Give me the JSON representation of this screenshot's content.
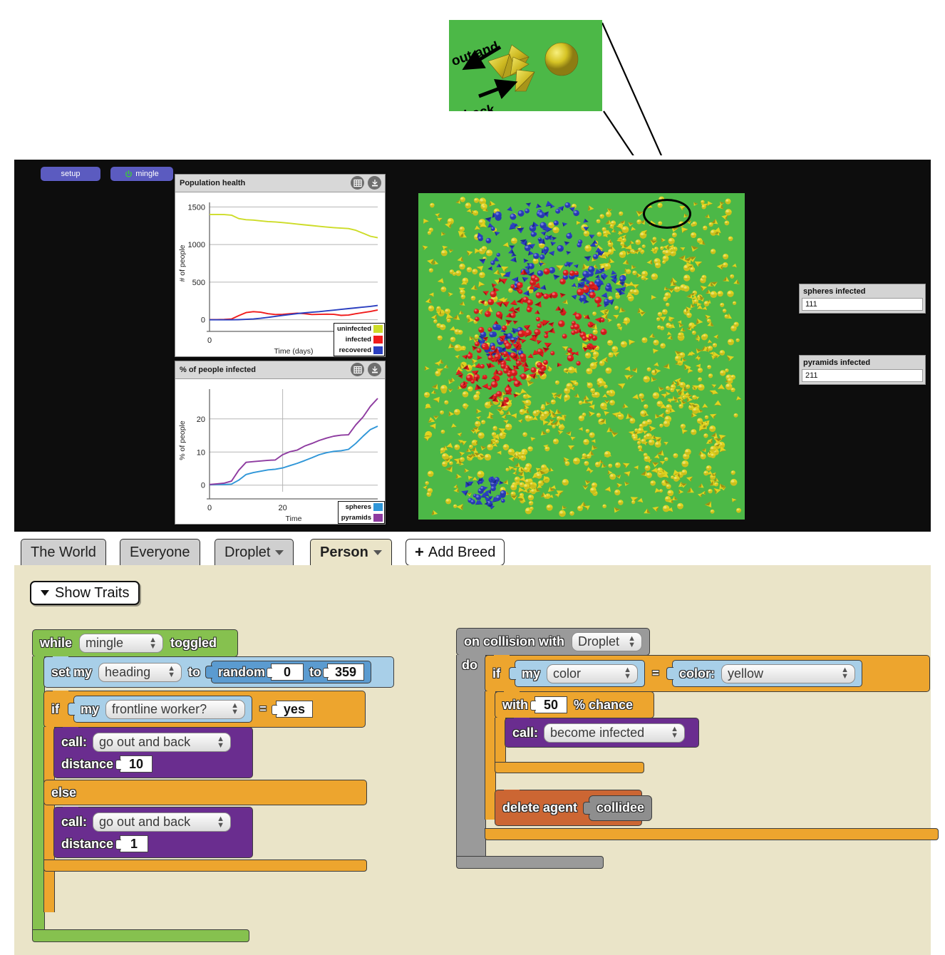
{
  "callout": {
    "label_out": "out and",
    "label_back": "back",
    "bg_color": "#4cb847",
    "agent_color": "#d4c935"
  },
  "toolbar": {
    "setup_label": "setup",
    "mingle_label": "mingle",
    "button_color": "#5b5bc0",
    "power_icon_color": "#3ec93e"
  },
  "charts": [
    {
      "title": "Population health",
      "grid_icon": "table-icon",
      "download_icon": "download-icon"
    },
    {
      "title": "% of people infected",
      "grid_icon": "table-icon",
      "download_icon": "download-icon"
    }
  ],
  "chart_data": [
    {
      "type": "line",
      "title": "Population health",
      "xlabel": "Time (days)",
      "ylabel": "# of people",
      "xlim": [
        0,
        46
      ],
      "ylim": [
        -60,
        1560
      ],
      "xticks": [
        0
      ],
      "yticks": [
        0,
        500,
        1000,
        1500
      ],
      "grid": true,
      "legend_position": "bottom-right",
      "series": [
        {
          "name": "uninfected",
          "color": "#cddc27",
          "x": [
            0,
            2,
            4,
            6,
            8,
            10,
            12,
            14,
            16,
            18,
            20,
            22,
            24,
            26,
            28,
            30,
            32,
            34,
            36,
            38,
            40,
            42,
            44,
            46
          ],
          "values": [
            1400,
            1400,
            1398,
            1390,
            1345,
            1330,
            1325,
            1315,
            1305,
            1300,
            1292,
            1282,
            1272,
            1262,
            1252,
            1242,
            1232,
            1225,
            1218,
            1212,
            1190,
            1150,
            1110,
            1090
          ]
        },
        {
          "name": "infected",
          "color": "#f01c1c",
          "x": [
            0,
            2,
            4,
            6,
            8,
            10,
            12,
            14,
            16,
            18,
            20,
            22,
            24,
            26,
            28,
            30,
            32,
            34,
            36,
            38,
            40,
            42,
            44,
            46
          ],
          "values": [
            2,
            2,
            4,
            10,
            55,
            95,
            108,
            100,
            80,
            70,
            72,
            80,
            88,
            80,
            70,
            72,
            75,
            72,
            58,
            62,
            80,
            95,
            110,
            130
          ]
        },
        {
          "name": "recovered",
          "color": "#2b3fc0",
          "x": [
            0,
            2,
            4,
            6,
            8,
            10,
            12,
            14,
            16,
            18,
            20,
            22,
            24,
            26,
            28,
            30,
            32,
            34,
            36,
            38,
            40,
            42,
            44,
            46
          ],
          "values": [
            0,
            0,
            0,
            0,
            2,
            5,
            10,
            20,
            32,
            45,
            58,
            70,
            82,
            92,
            100,
            108,
            118,
            128,
            138,
            148,
            158,
            168,
            178,
            190
          ]
        }
      ]
    },
    {
      "type": "line",
      "title": "% of people infected",
      "xlabel": "Time",
      "ylabel": "% of people",
      "xlim": [
        0,
        46
      ],
      "ylim": [
        -2,
        29
      ],
      "xticks": [
        0,
        20
      ],
      "yticks": [
        0,
        10,
        20
      ],
      "grid": true,
      "legend_position": "bottom-right",
      "series": [
        {
          "name": "spheres",
          "color": "#2f96d8",
          "x": [
            0,
            2,
            4,
            6,
            8,
            10,
            12,
            14,
            16,
            18,
            20,
            22,
            24,
            26,
            28,
            30,
            32,
            34,
            36,
            38,
            40,
            42,
            44,
            46
          ],
          "values": [
            0.1,
            0.2,
            0.2,
            0.3,
            1.5,
            3.2,
            3.8,
            4.2,
            4.6,
            4.8,
            5.2,
            5.9,
            6.6,
            7.4,
            8.3,
            9.2,
            9.8,
            10.2,
            10.4,
            10.8,
            12.6,
            14.8,
            16.8,
            17.8
          ]
        },
        {
          "name": "pyramids",
          "color": "#8e3ba0",
          "x": [
            0,
            2,
            4,
            6,
            8,
            10,
            12,
            14,
            16,
            18,
            20,
            22,
            24,
            26,
            28,
            30,
            32,
            34,
            36,
            38,
            40,
            42,
            44,
            46
          ],
          "values": [
            0.2,
            0.4,
            0.6,
            1.2,
            4.5,
            6.9,
            7.1,
            7.3,
            7.5,
            7.6,
            9.2,
            10.1,
            10.6,
            11.8,
            12.6,
            13.5,
            14.2,
            14.8,
            15.1,
            15.2,
            18.2,
            20.6,
            23.8,
            26.2
          ]
        }
      ]
    }
  ],
  "monitors": [
    {
      "label": "spheres infected",
      "value": "111"
    },
    {
      "label": "pyramids infected",
      "value": "211"
    }
  ],
  "tabs": [
    {
      "label": "The World",
      "has_caret": false,
      "active": false
    },
    {
      "label": "Everyone",
      "has_caret": false,
      "active": false
    },
    {
      "label": "Droplet",
      "has_caret": true,
      "active": false
    },
    {
      "label": "Person",
      "has_caret": true,
      "active": true
    }
  ],
  "add_breed": {
    "plus": "+",
    "label": "Add Breed"
  },
  "show_traits": {
    "label": "Show Traits"
  },
  "blocks": {
    "left": {
      "while_kw": "while",
      "while_target": "mingle",
      "while_suffix": "toggled",
      "set_kw": "set my",
      "set_trait": "heading",
      "set_to": "to",
      "random_kw": "random",
      "random_min": "0",
      "random_to": "to",
      "random_max": "359",
      "if_kw": "if",
      "if_my": "my",
      "if_trait": "frontline worker?",
      "if_eq": "=",
      "if_value": "yes",
      "call1_kw": "call:",
      "call1_proc": "go out and back",
      "dist1_kw": "distance",
      "dist1_val": "10",
      "else_kw": "else",
      "call2_kw": "call:",
      "call2_proc": "go out and back",
      "dist2_kw": "distance",
      "dist2_val": "1"
    },
    "right": {
      "collision_kw": "on collision with",
      "collision_breed": "Droplet",
      "do_kw": "do",
      "if_kw": "if",
      "if_my": "my",
      "if_trait": "color",
      "if_eq": "=",
      "color_kw": "color:",
      "color_val": "yellow",
      "with_kw": "with",
      "chance_val": "50",
      "chance_suffix": "% chance",
      "call_kw": "call:",
      "call_proc": "become infected",
      "delete_kw": "delete agent",
      "delete_target": "collidee"
    }
  },
  "colors": {
    "workspace_bg": "#eae4c8",
    "canvas_bg": "#0d0d0d",
    "green_block": "#86c14f",
    "blue_block": "#a8cfe8",
    "orange_block": "#eda52e",
    "purple_block": "#6a2d8f",
    "gray_block": "#9a9a9a",
    "rust_block": "#cc6633"
  }
}
